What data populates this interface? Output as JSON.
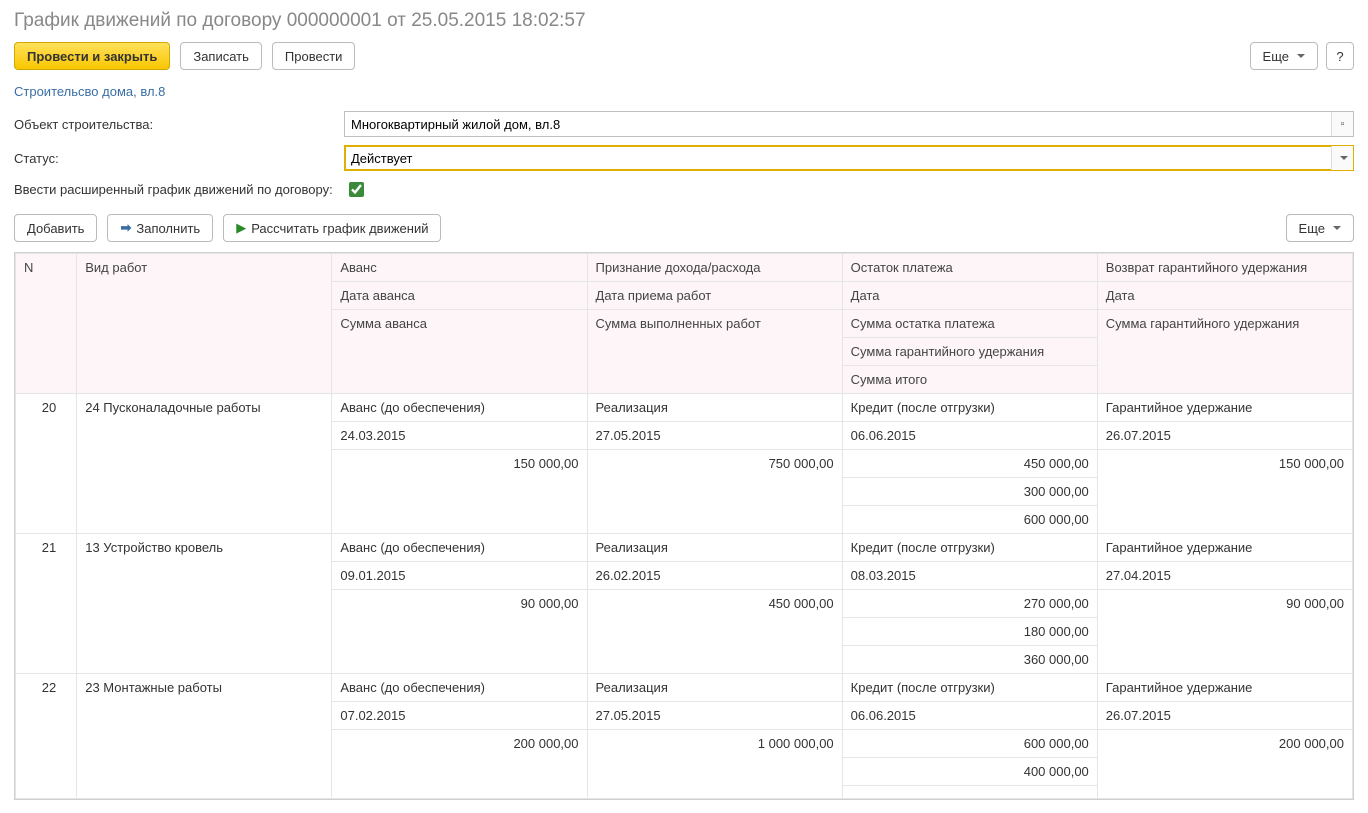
{
  "title": "График движений по договору 000000001 от 25.05.2015 18:02:57",
  "toolbar": {
    "post_close": "Провести и закрыть",
    "save": "Записать",
    "post": "Провести",
    "more": "Еще",
    "help": "?"
  },
  "link": "Строительсво дома, вл.8",
  "form": {
    "object_label": "Объект строительства:",
    "object_value": "Многоквартирный жилой дом, вл.8",
    "status_label": "Статус:",
    "status_value": "Действует",
    "extended_label": "Ввести расширенный график движений по договору:",
    "extended_checked": true
  },
  "toolbar2": {
    "add": "Добавить",
    "fill": "Заполнить",
    "calc": "Рассчитать график движений",
    "more": "Еще"
  },
  "headers": {
    "n": "N",
    "work": "Вид работ",
    "advance": "Аванс",
    "advance_date": "Дата аванса",
    "advance_sum": "Сумма аванса",
    "income": "Признание дохода/расхода",
    "income_date": "Дата приема работ",
    "income_sum": "Сумма выполненных работ",
    "balance": "Остаток платежа",
    "bal_date": "Дата",
    "bal_sum": "Сумма остатка платежа",
    "bal_guarantee": "Сумма гарантийного удержания",
    "bal_total": "Сумма итого",
    "guarantee": "Возврат гарантийного удержания",
    "g_date": "Дата",
    "g_sum": "Сумма гарантийного удержания"
  },
  "rows": [
    {
      "n": "20",
      "work": "24 Пусконаладочные работы",
      "adv_type": "Аванс (до обеспечения)",
      "adv_date": "24.03.2015",
      "adv_sum": "150 000,00",
      "inc_type": "Реализация",
      "inc_date": "27.05.2015",
      "inc_sum": "750 000,00",
      "bal_type": "Кредит (после отгрузки)",
      "bal_date": "06.06.2015",
      "bal_sum": "450 000,00",
      "bal_guarantee": "300 000,00",
      "bal_total": "600 000,00",
      "g_type": "Гарантийное удержание",
      "g_date": "26.07.2015",
      "g_sum": "150 000,00"
    },
    {
      "n": "21",
      "work": "13 Устройство кровель",
      "adv_type": "Аванс (до обеспечения)",
      "adv_date": "09.01.2015",
      "adv_sum": "90 000,00",
      "inc_type": "Реализация",
      "inc_date": "26.02.2015",
      "inc_sum": "450 000,00",
      "bal_type": "Кредит (после отгрузки)",
      "bal_date": "08.03.2015",
      "bal_sum": "270 000,00",
      "bal_guarantee": "180 000,00",
      "bal_total": "360 000,00",
      "g_type": "Гарантийное удержание",
      "g_date": "27.04.2015",
      "g_sum": "90 000,00"
    },
    {
      "n": "22",
      "work": "23 Монтажные работы",
      "adv_type": "Аванс (до обеспечения)",
      "adv_date": "07.02.2015",
      "adv_sum": "200 000,00",
      "inc_type": "Реализация",
      "inc_date": "27.05.2015",
      "inc_sum": "1 000 000,00",
      "bal_type": "Кредит (после отгрузки)",
      "bal_date": "06.06.2015",
      "bal_sum": "600 000,00",
      "bal_guarantee": "400 000,00",
      "bal_total": "",
      "g_type": "Гарантийное удержание",
      "g_date": "26.07.2015",
      "g_sum": "200 000,00"
    }
  ]
}
